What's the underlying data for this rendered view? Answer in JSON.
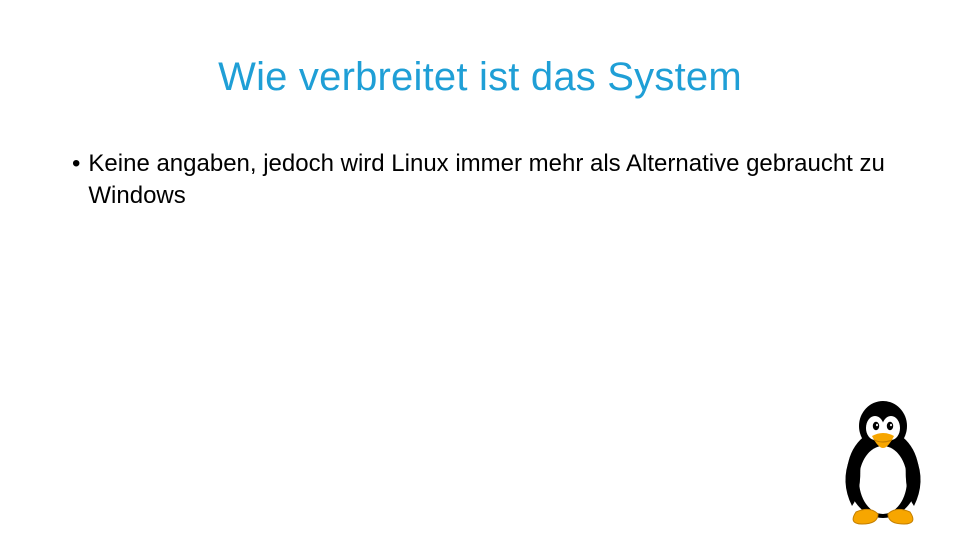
{
  "slide": {
    "title": "Wie verbreitet ist das System",
    "bullets": [
      "Keine angaben, jedoch wird Linux immer mehr als Alternative gebraucht zu Windows"
    ],
    "accent_color": "#1f9fd6",
    "mascot": "tux-penguin"
  }
}
